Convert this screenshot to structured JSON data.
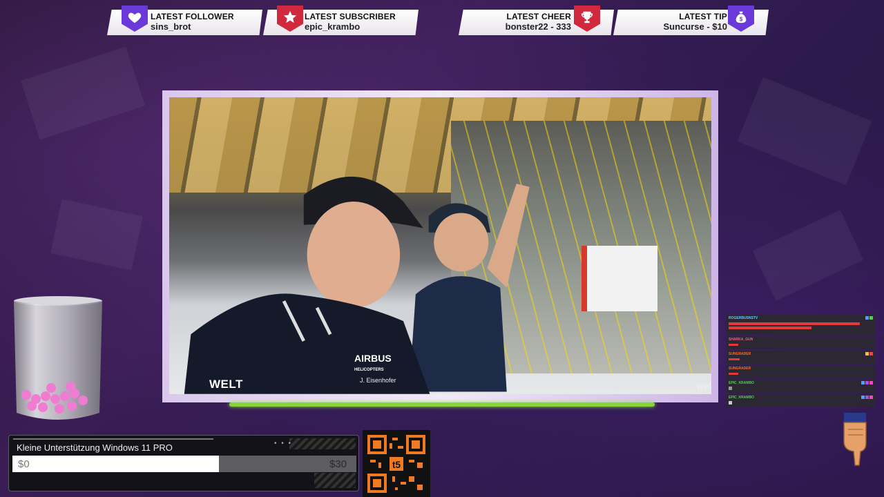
{
  "alerts": {
    "follower": {
      "label": "LATEST FOLLOWER",
      "value": "sins_brot",
      "icon": "heart-icon",
      "color": "#6a3ad8"
    },
    "subscriber": {
      "label": "LATEST SUBSCRIBER",
      "value": "epic_krambo",
      "icon": "star-icon",
      "color": "#d0283c"
    },
    "cheer": {
      "label": "LATEST CHEER",
      "value": "bonster22 - 333",
      "icon": "trophy-icon",
      "color": "#d0283c"
    },
    "tip": {
      "label": "LATEST TIP",
      "value": "Suncurse - $10",
      "icon": "money-bag-icon",
      "color": "#6a3ad8"
    }
  },
  "video": {
    "watermark": "WELT",
    "watermark_right": "wel",
    "shirt_logo": "AIRBUS",
    "shirt_sub": "HELICOPTERS",
    "name_tag": "J. Eisenhofer"
  },
  "donation_goal": {
    "title": "Kleine Unterstützung Windows 11 PRO",
    "current": "$0",
    "target": "$30",
    "progress_fraction": 0.6,
    "dots": "• • •"
  },
  "qr": {
    "center_label": "t5"
  },
  "chat": [
    {
      "user": "ROGERBUSNSTV",
      "text": "",
      "user_color": "#6bc6ff"
    },
    {
      "user": "",
      "text": "",
      "user_color": "#ff5555"
    },
    {
      "user": "SHARKA_GUN",
      "text": "",
      "user_color": "#ff5a8a"
    },
    {
      "user": "SUNGRADER",
      "text": "",
      "user_color": "#ff6a2a"
    },
    {
      "user": "SUNGRADER",
      "text": "",
      "user_color": "#ff6a2a"
    },
    {
      "user": "EPIC_KRAMBO",
      "text": "",
      "user_color": "#4fd44f"
    },
    {
      "user": "EPIC_KRAMBO",
      "text": "",
      "user_color": "#4fd44f"
    }
  ]
}
